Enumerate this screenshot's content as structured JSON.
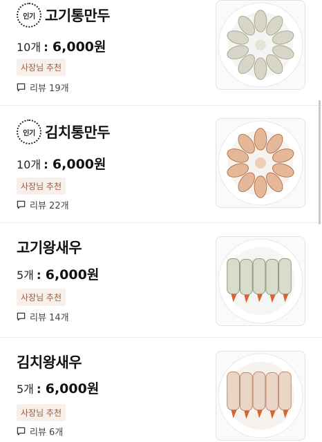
{
  "items": [
    {
      "popular_badge": "인기",
      "title": "고기통만두",
      "qty": "10개",
      "colon": ":",
      "price": "6,000원",
      "tag": "사장님 추천",
      "review_label": "리뷰 19개",
      "image": "meat-dumplings-plate"
    },
    {
      "popular_badge": "인기",
      "title": "김치통만두",
      "qty": "10개",
      "colon": ":",
      "price": "6,000원",
      "tag": "사장님 추천",
      "review_label": "리뷰 22개",
      "image": "kimchi-dumplings-plate"
    },
    {
      "title": "고기왕새우",
      "qty": "5개",
      "colon": ":",
      "price": "6,000원",
      "tag": "사장님 추천",
      "review_label": "리뷰 14개",
      "image": "meat-king-shrimp-plate"
    },
    {
      "title": "김치왕새우",
      "qty": "5개",
      "colon": ":",
      "price": "6,000원",
      "tag": "사장님 추천",
      "review_label": "리뷰 6개",
      "image": "kimchi-king-shrimp-plate"
    }
  ]
}
